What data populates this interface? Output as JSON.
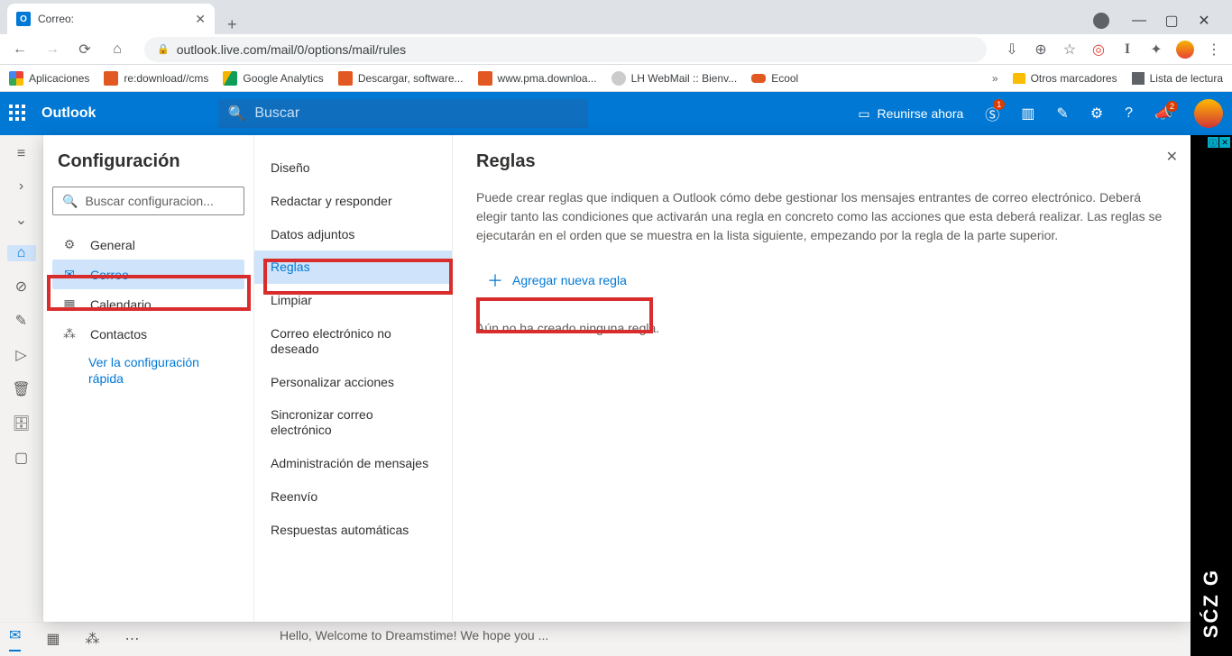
{
  "browser": {
    "tab_title": "Correo:",
    "url": "outlook.live.com/mail/0/options/mail/rules",
    "bookmarks": [
      "Aplicaciones",
      "re:download//cms",
      "Google Analytics",
      "Descargar, software...",
      "www.pma.downloa...",
      "LH WebMail :: Bienv...",
      "Ecool"
    ],
    "other_bookmarks": "Otros marcadores",
    "reading_list": "Lista de lectura"
  },
  "header": {
    "app": "Outlook",
    "search_placeholder": "Buscar",
    "meet_label": "Reunirse ahora",
    "skype_badge": "1",
    "notif_badge": "2"
  },
  "settings": {
    "title": "Configuración",
    "search_placeholder": "Buscar configuracion...",
    "nav": [
      {
        "icon": "⚙",
        "label": "General"
      },
      {
        "icon": "✉",
        "label": "Correo"
      },
      {
        "icon": "▦",
        "label": "Calendario"
      },
      {
        "icon": "⁂",
        "label": "Contactos"
      }
    ],
    "quick_link": "Ver la configuración rápida",
    "sub": [
      "Diseño",
      "Redactar y responder",
      "Datos adjuntos",
      "Reglas",
      "Limpiar",
      "Correo electrónico no deseado",
      "Personalizar acciones",
      "Sincronizar correo electrónico",
      "Administración de mensajes",
      "Reenvío",
      "Respuestas automáticas"
    ],
    "content": {
      "heading": "Reglas",
      "description": "Puede crear reglas que indiquen a Outlook cómo debe gestionar los mensajes entrantes de correo electrónico. Deberá elegir tanto las condiciones que activarán una regla en concreto como las acciones que esta deberá realizar. Las reglas se ejecutarán en el orden que se muestra en la lista siguiente, empezando por la regla de la parte superior.",
      "add_label": "Agregar nueva regla",
      "empty": "Aún no ha creado ninguna regla."
    }
  },
  "ad_text": "SĆZ G",
  "preview_line": "Hello, Welcome to Dreamstime! We hope you ..."
}
